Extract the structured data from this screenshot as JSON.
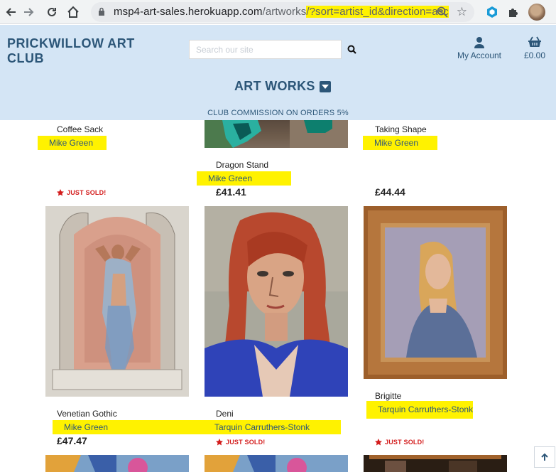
{
  "browser": {
    "url_host": "msp4-art-sales.herokuapp.com",
    "url_path": "/artworks",
    "url_query": "/?sort=artist_id&direction=asc"
  },
  "site": {
    "logo_line1": "PRICKWILLOW ART",
    "logo_line2": "CLUB",
    "search_placeholder": "Search our site",
    "account_label": "My Account",
    "bag_total": "£0.00",
    "section_title": "ART WORKS",
    "commission_banner": "CLUB COMMISSION ON ORDERS 5%"
  },
  "artworks": [
    {
      "title": "Coffee Sack",
      "artist": "Mike Green",
      "price": "",
      "sold_label": "JUST SOLD!"
    },
    {
      "title": "Dragon Stand",
      "artist": "Mike Green",
      "price": "£41.41",
      "sold_label": ""
    },
    {
      "title": "Taking Shape",
      "artist": "Mike Green",
      "price": "£44.44",
      "sold_label": ""
    },
    {
      "title": "Venetian Gothic",
      "artist": "Mike Green",
      "price": "£47.47",
      "sold_label": ""
    },
    {
      "title": "Deni",
      "artist": "Tarquin Carruthers-Stonk",
      "price": "",
      "sold_label": "JUST SOLD!"
    },
    {
      "title": "Brigitte",
      "artist": "Tarquin Carruthers-Stonk",
      "price": "",
      "sold_label": "JUST SOLD!"
    }
  ],
  "colors": {
    "header_bg": "#d4e5f5",
    "brand": "#2c5678",
    "highlight": "#fff200",
    "sold_red": "#d31c1c"
  }
}
